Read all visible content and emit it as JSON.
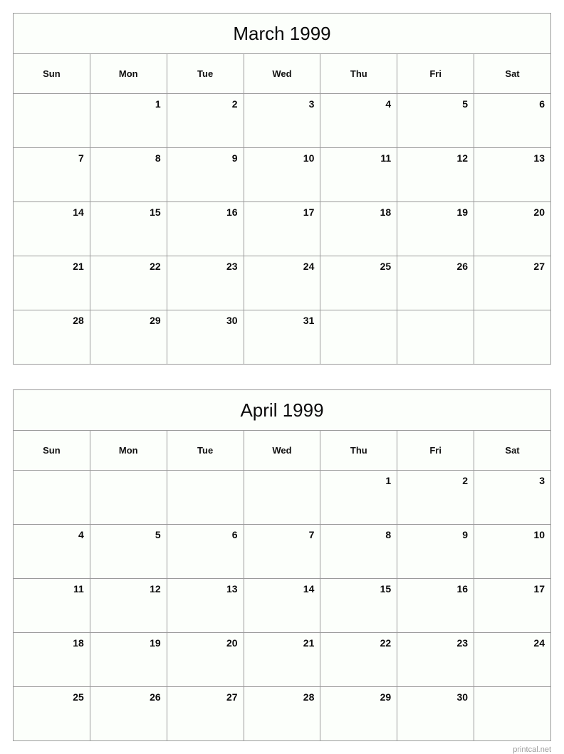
{
  "page": {
    "footer_credit": "printcal.net"
  },
  "weekdays": [
    "Sun",
    "Mon",
    "Tue",
    "Wed",
    "Thu",
    "Fri",
    "Sat"
  ],
  "colors": {
    "border": "#9a9a9a",
    "cell_background": "#fcfffb",
    "text": "#0a0a0a",
    "footer_text": "#9b9b9b"
  },
  "calendars": [
    {
      "title": "March 1999",
      "month": "March",
      "year": "1999",
      "first_weekday_index": 1,
      "days_in_month": 31,
      "weeks": [
        [
          "",
          "1",
          "2",
          "3",
          "4",
          "5",
          "6"
        ],
        [
          "7",
          "8",
          "9",
          "10",
          "11",
          "12",
          "13"
        ],
        [
          "14",
          "15",
          "16",
          "17",
          "18",
          "19",
          "20"
        ],
        [
          "21",
          "22",
          "23",
          "24",
          "25",
          "26",
          "27"
        ],
        [
          "28",
          "29",
          "30",
          "31",
          "",
          "",
          ""
        ]
      ]
    },
    {
      "title": "April 1999",
      "month": "April",
      "year": "1999",
      "first_weekday_index": 4,
      "days_in_month": 30,
      "weeks": [
        [
          "",
          "",
          "",
          "",
          "1",
          "2",
          "3"
        ],
        [
          "4",
          "5",
          "6",
          "7",
          "8",
          "9",
          "10"
        ],
        [
          "11",
          "12",
          "13",
          "14",
          "15",
          "16",
          "17"
        ],
        [
          "18",
          "19",
          "20",
          "21",
          "22",
          "23",
          "24"
        ],
        [
          "25",
          "26",
          "27",
          "28",
          "29",
          "30",
          ""
        ]
      ]
    }
  ]
}
